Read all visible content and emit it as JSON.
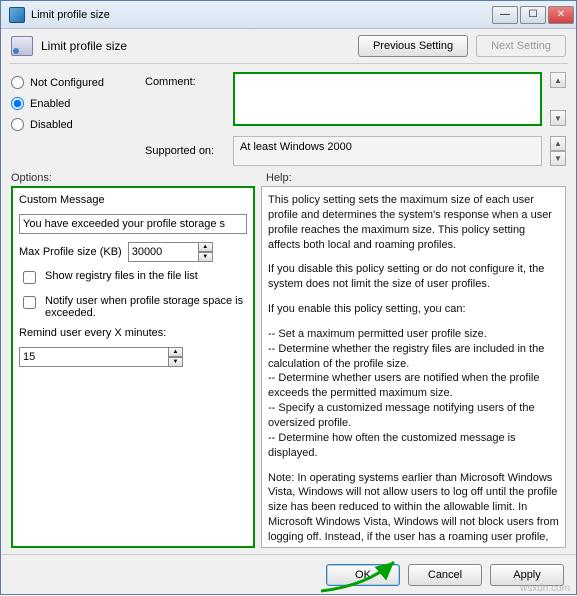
{
  "titlebar": {
    "title": "Limit profile size"
  },
  "header": {
    "title": "Limit profile size",
    "prev_btn": "Previous Setting",
    "next_btn": "Next Setting"
  },
  "radios": {
    "not_configured": "Not Configured",
    "enabled": "Enabled",
    "disabled": "Disabled"
  },
  "comment": {
    "label": "Comment:",
    "value": ""
  },
  "supported": {
    "label": "Supported on:",
    "value": "At least Windows 2000"
  },
  "labels": {
    "options": "Options:",
    "help": "Help:"
  },
  "options": {
    "custom_msg_label": "Custom Message",
    "custom_msg_value": "You have exceeded your profile storage s",
    "max_profile_label": "Max Profile size (KB)",
    "max_profile_value": "30000",
    "show_registry": "Show registry files in the file list",
    "notify_user": "Notify user when profile storage space is exceeded.",
    "remind_label": "Remind user every X minutes:",
    "remind_value": "15"
  },
  "help": {
    "p1": "This policy setting sets the maximum size of each user profile and determines the system's response when a user profile reaches the maximum size. This policy setting affects both local and roaming profiles.",
    "p2": "If you disable this policy setting or do not configure it, the system does not limit the size of user profiles.",
    "p3": "If you enable this policy setting, you can:",
    "b1": "-- Set a maximum permitted user profile size.",
    "b2": "-- Determine whether the registry files are included in the calculation of the profile size.",
    "b3": "-- Determine whether users are notified when the profile exceeds the permitted maximum size.",
    "b4": "-- Specify a customized message notifying users of the oversized profile.",
    "b5": "-- Determine how often the customized message is displayed.",
    "note": "Note: In operating systems earlier than Microsoft Windows Vista, Windows will not allow users to log off until the profile size has been reduced to within the allowable limit. In Microsoft Windows Vista, Windows will not block users from logging off. Instead, if the user has a roaming user profile, Windows will not synchronize the user's profile with the roaming profile server if the maximum profile size limit specified here is exceeded."
  },
  "footer": {
    "ok": "OK",
    "cancel": "Cancel",
    "apply": "Apply"
  },
  "watermark": "wsxdn.com"
}
